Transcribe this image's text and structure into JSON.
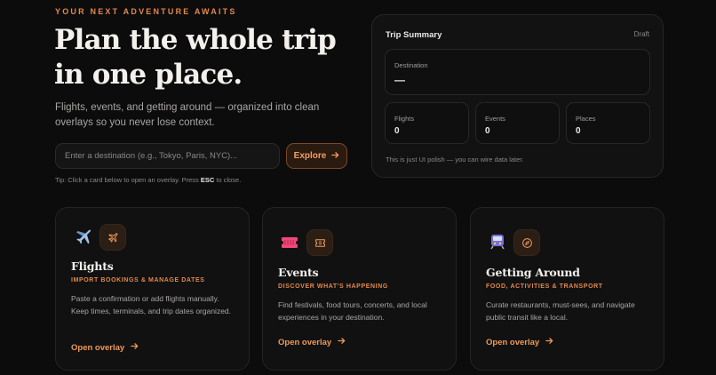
{
  "hero": {
    "eyebrow": "YOUR NEXT ADVENTURE AWAITS",
    "headline": "Plan the whole trip in one place.",
    "subtitle": "Flights, events, and getting around — organized into clean overlays so you never lose context.",
    "search": {
      "placeholder": "Enter a destination (e.g., Tokyo, Paris, NYC)...",
      "value": ""
    },
    "explore_label": "Explore",
    "tip_prefix": "Tip: Click a card below to open an overlay. Press",
    "tip_key": "ESC",
    "tip_suffix": "to close."
  },
  "summary": {
    "title": "Trip Summary",
    "status": "Draft",
    "destination": {
      "label": "Destination",
      "value": "—"
    },
    "stats": [
      {
        "label": "Flights",
        "value": "0"
      },
      {
        "label": "Events",
        "value": "0"
      },
      {
        "label": "Places",
        "value": "0"
      }
    ],
    "note": "This is just UI polish — you can wire data later."
  },
  "cards": [
    {
      "title": "Flights",
      "subtitle": "IMPORT BOOKINGS & MANAGE DATES",
      "description": "Paste a confirmation or add flights manually. Keep times, terminals, and trip dates organized.",
      "link": "Open overlay",
      "emoji_icon": "airplane-icon",
      "badge_icon": "plane-outline-icon"
    },
    {
      "title": "Events",
      "subtitle": "DISCOVER WHAT'S HAPPENING",
      "description": "Find festivals, food tours, concerts, and local experiences in your destination.",
      "link": "Open overlay",
      "emoji_icon": "ticket-icon",
      "badge_icon": "ticket-outline-icon"
    },
    {
      "title": "Getting Around",
      "subtitle": "FOOD, ACTIVITIES & TRANSPORT",
      "description": "Curate restaurants, must-sees, and navigate public transit like a local.",
      "link": "Open overlay",
      "emoji_icon": "train-icon",
      "badge_icon": "compass-icon"
    }
  ],
  "colors": {
    "background": "#0c0c0d",
    "accent": "#e3884a",
    "panel": "#121213",
    "text": "#f4f1ec",
    "muted": "#a9a6a1"
  }
}
